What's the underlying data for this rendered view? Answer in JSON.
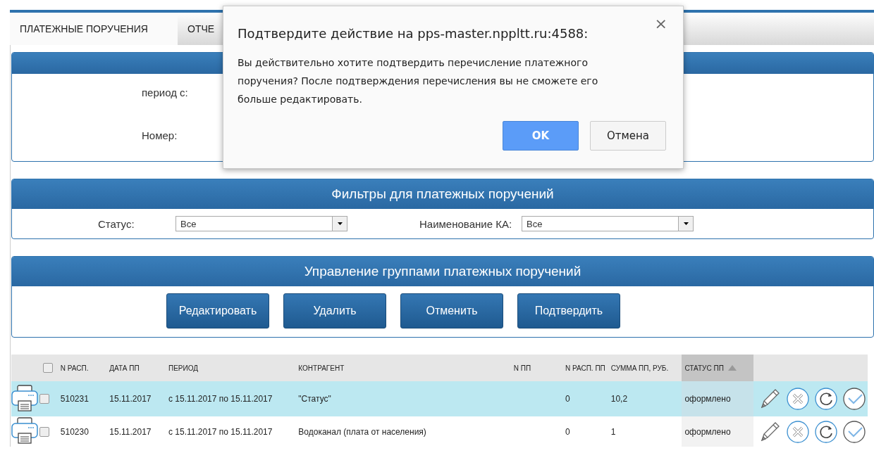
{
  "tabs": [
    {
      "label": "ПЛАТЕЖНЫЕ ПОРУЧЕНИЯ",
      "selected": true
    },
    {
      "label": "ОТЧЕ",
      "selected": false
    }
  ],
  "period_panel": {
    "fields": [
      {
        "label": "период с:"
      },
      {
        "label": "Номер:"
      }
    ]
  },
  "filters": {
    "title": "Фильтры для платежных поручений",
    "fields": [
      {
        "label": "Статус:",
        "value": "Все"
      },
      {
        "label": "Наименование КА:",
        "value": "Все"
      }
    ]
  },
  "group_actions": {
    "title": "Управление группами платежных поручений",
    "buttons": [
      "Редактировать",
      "Удалить",
      "Отменить",
      "Подтвердить"
    ]
  },
  "table": {
    "header_checked": false,
    "columns": [
      {
        "label": "N РАСП.",
        "sorted": false
      },
      {
        "label": "ДАТА ПП",
        "sorted": false
      },
      {
        "label": "ПЕРИОД",
        "sorted": false
      },
      {
        "label": "КОНТРАГЕНТ",
        "sorted": false
      },
      {
        "label": "N ПП",
        "sorted": false
      },
      {
        "label": "N РАСП. ПП",
        "sorted": false
      },
      {
        "label": "СУММА ПП, РУБ.",
        "sorted": false
      },
      {
        "label": "СТАТУС ПП",
        "sorted": true
      }
    ],
    "rows": [
      {
        "selected": true,
        "checked": false,
        "cells": [
          "510231",
          "15.11.2017",
          "с 15.11.2017 по 15.11.2017",
          "\"Статус\"",
          "",
          "0",
          "10,2",
          "оформлено"
        ]
      },
      {
        "selected": false,
        "checked": false,
        "cells": [
          "510230",
          "15.11.2017",
          "с 15.11.2017 по 15.11.2017",
          "Водоканал (плата от населения)",
          "",
          "0",
          "1",
          "оформлено"
        ]
      }
    ]
  },
  "dialog": {
    "title": "Подтвердите действие на pps-master.nppltt.ru:4588:",
    "close": "×",
    "message": "Вы действительно хотите подтвердить перечисление платежного поручения? После подтверждения перечисления вы не сможете его больше редактировать.",
    "buttons": [
      {
        "label": "OK",
        "primary": true
      },
      {
        "label": "Отмена",
        "primary": false
      }
    ]
  }
}
